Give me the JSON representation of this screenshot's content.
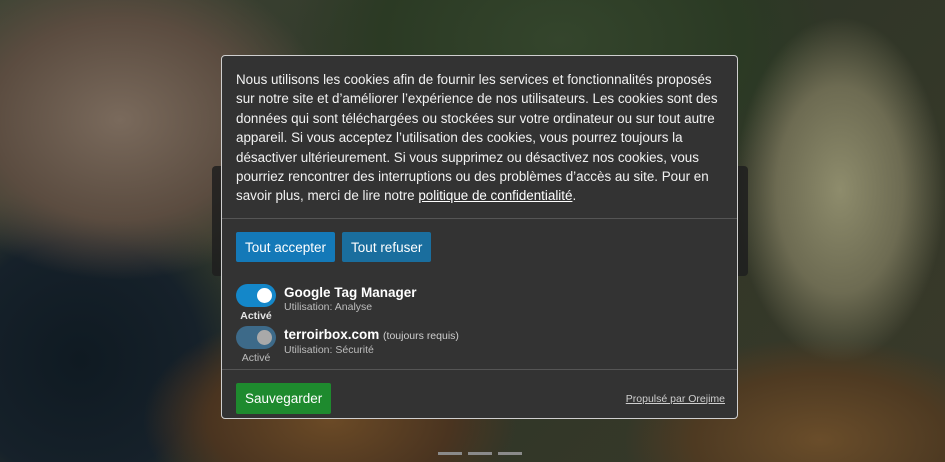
{
  "consent": {
    "description": "Nous utilisons les cookies afin de fournir les services et fonctionnalités proposés sur notre site et d’améliorer l’expérience de nos utilisateurs. Les cookies sont des données qui sont téléchargées ou stockées sur votre ordinateur ou sur tout autre appareil. Si vous acceptez l’utilisation des cookies, vous pourrez toujours la désactiver ultérieurement. Si vous supprimez ou désactivez nos cookies, vous pourriez rencontrer des interruptions ou des problèmes d’accès au site. Pour en savoir plus, merci de lire notre ",
    "privacy_link": "politique de confidentialité",
    "description_end": ".",
    "accept_all": "Tout accepter",
    "refuse_all": "Tout refuser",
    "purposes": [
      {
        "title": "Google Tag Manager",
        "required": "",
        "usage": "Utilisation: Analyse",
        "state_label": "Activé",
        "enabled": true
      },
      {
        "title": "terroirbox.com",
        "required": "(toujours requis)",
        "usage": "Utilisation: Sécurité",
        "state_label": "Activé",
        "enabled": true
      }
    ],
    "save": "Sauvegarder",
    "powered_by": "Propulsé par Orejime"
  },
  "colors": {
    "modal_bg": "#333333",
    "accent_blue": "#1479b8",
    "save_green": "#1e8a2e"
  }
}
